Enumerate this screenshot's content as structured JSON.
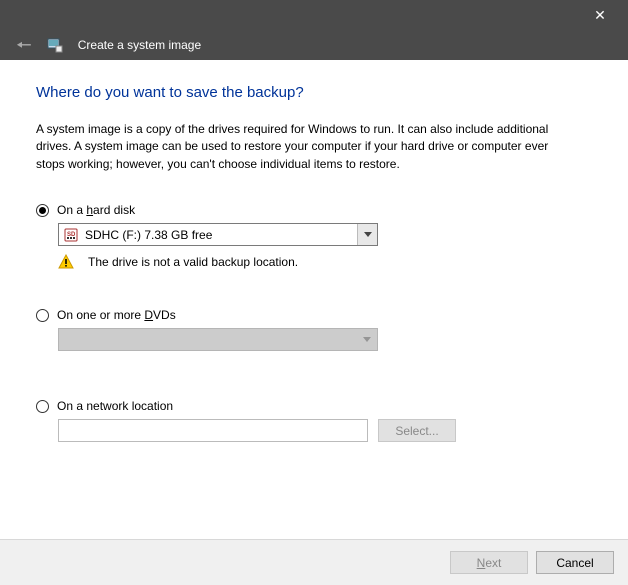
{
  "window": {
    "title": "Create a system image"
  },
  "heading": "Where do you want to save the backup?",
  "description": "A system image is a copy of the drives required for Windows to run. It can also include additional drives. A system image can be used to restore your computer if your hard drive or computer ever stops working; however, you can't choose individual items to restore.",
  "options": {
    "hard_disk": {
      "label_pre": "On a ",
      "label_accel": "h",
      "label_post": "ard disk",
      "selected_drive": "SDHC (F:)  7.38 GB free",
      "warning": "The drive is not a valid backup location."
    },
    "dvd": {
      "label_pre": "On one or more ",
      "label_accel": "D",
      "label_post": "VDs"
    },
    "network": {
      "label": "On a network location",
      "select_button": "Select...",
      "value": ""
    }
  },
  "buttons": {
    "next_accel": "N",
    "next_post": "ext",
    "cancel": "Cancel"
  }
}
